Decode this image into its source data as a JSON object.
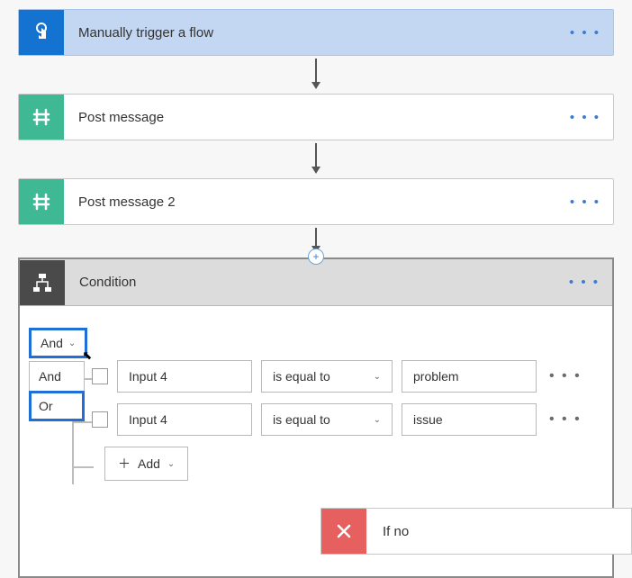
{
  "trigger": {
    "title": "Manually trigger a flow"
  },
  "actions": [
    {
      "title": "Post message"
    },
    {
      "title": "Post message 2"
    }
  ],
  "condition": {
    "title": "Condition",
    "operator": "And",
    "dropdown": {
      "opt1": "And",
      "opt2": "Or"
    },
    "rows": [
      {
        "operand": "Input 4",
        "comparator": "is equal to",
        "value": "problem"
      },
      {
        "operand": "Input 4",
        "comparator": "is equal to",
        "value": "issue"
      }
    ],
    "add_label": "Add"
  },
  "branches": {
    "if_no": "If no"
  },
  "glyphs": {
    "menu": "• • •",
    "plus": "＋",
    "chev": "⌄",
    "cursor": "↖"
  }
}
